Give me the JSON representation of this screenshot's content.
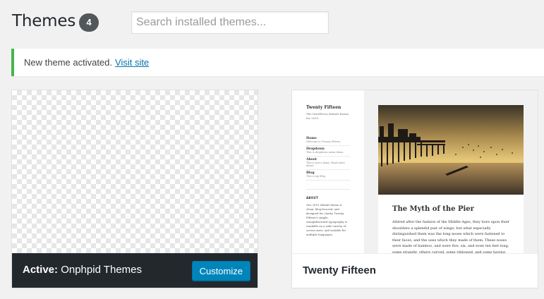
{
  "header": {
    "title": "Themes",
    "count": "4",
    "search_placeholder": "Search installed themes..."
  },
  "notice": {
    "text": "New theme activated.",
    "link": "Visit site",
    "accent_color": "#46b450"
  },
  "themes": [
    {
      "active_prefix": "Active:",
      "name": "Onphpid Themes",
      "customize_label": "Customize"
    },
    {
      "name": "Twenty Fifteen",
      "preview": {
        "site_title": "Twenty Fifteen",
        "site_description": "The WordPress default theme for 2015.",
        "menu": [
          {
            "label": "Home",
            "sub": "Welcome to Twenty Fifteen"
          },
          {
            "label": "Dropdown",
            "sub": "This is dropdown menu demo."
          },
          {
            "label": "About",
            "sub": "This is just a demo. Read more about"
          },
          {
            "label": "Blog",
            "sub": "This is my Blog"
          }
        ],
        "about_heading": "ABOUT",
        "about_text": "Our 2015 default theme is clean, blog-focused, and designed for clarity. Twenty Fifteen's simple, straightforward typography is readable on a wide variety of screen sizes, and suitable for multiple languages.",
        "post_title": "The Myth of the Pier",
        "post_text": "Attired after the fashion of the Middle Ages, they bore upon their shoulders a splendid pair of wings; but what especially distinguished them was the long noses which were fastened to their faces, and the uses which they made of them. These noses were made of bamboo, and were five, six, and even ten feet long, some straight, others curved, some ribboned, and some having imitation warts upon them."
      }
    }
  ]
}
